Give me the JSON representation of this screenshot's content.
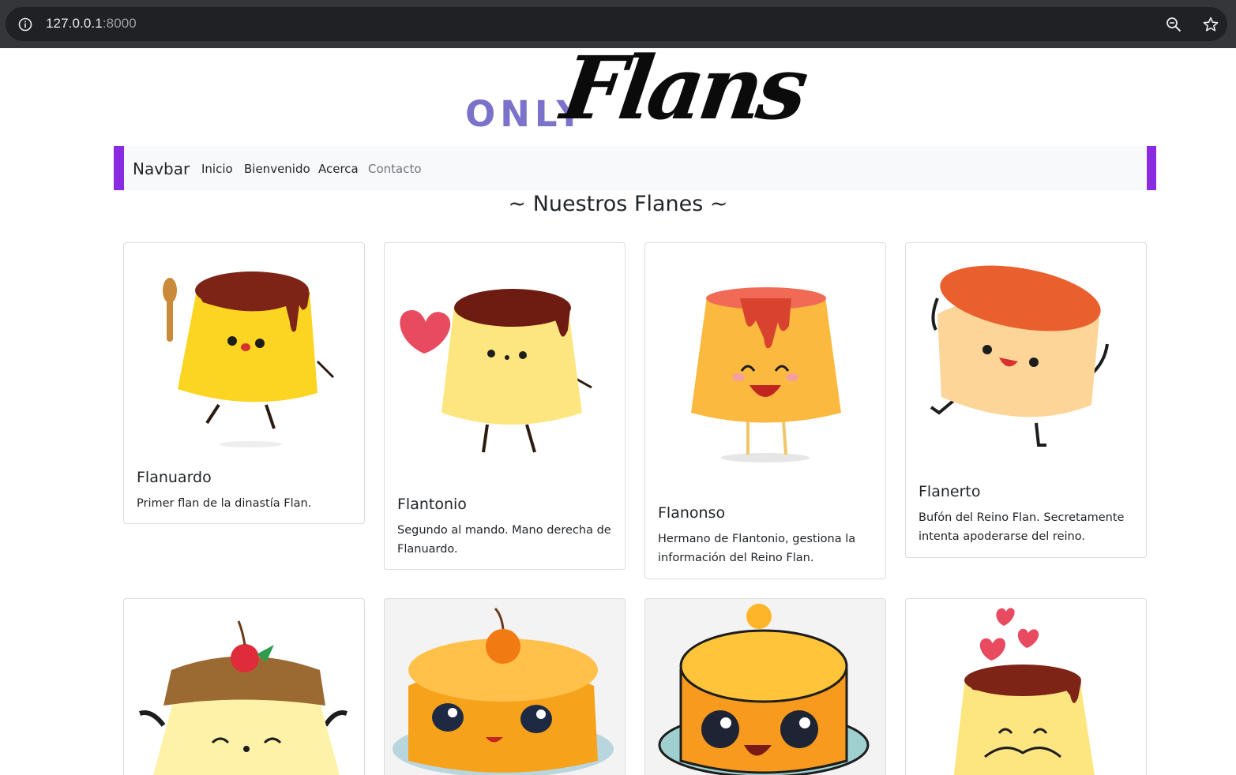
{
  "browser": {
    "url_host": "127.0.0.1",
    "url_port": ":8000"
  },
  "logo": {
    "only": "ONLY",
    "flans": "Flans"
  },
  "navbar": {
    "brand": "Navbar",
    "links": [
      "Inicio",
      "Bienvenido",
      "Acerca",
      "Contacto"
    ]
  },
  "section": {
    "title": "~ Nuestros Flanes ~"
  },
  "cards": [
    {
      "title": "Flanuardo",
      "text": "Primer flan de la dinastía Flan."
    },
    {
      "title": "Flantonio",
      "text": "Segundo al mando. Mano derecha de Flanuardo."
    },
    {
      "title": "Flanonso",
      "text": "Hermano de Flantonio, gestiona la información del Reino Flan."
    },
    {
      "title": "Flanerto",
      "text": "Bufón del Reino Flan. Secretamente intenta apoderarse del reino."
    }
  ],
  "colors": {
    "navbar_accent": "#8a2be2",
    "logo_only": "#7b72c9",
    "chrome_bg": "#35363a",
    "omnibox_bg": "#202124"
  }
}
